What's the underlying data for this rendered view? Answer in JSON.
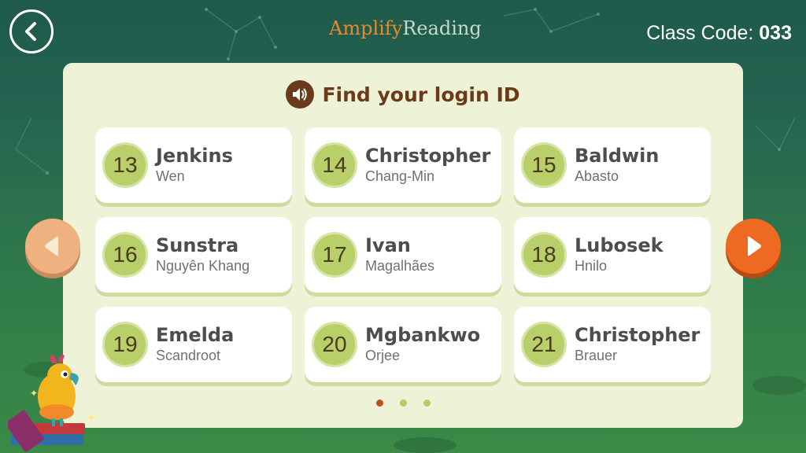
{
  "header": {
    "back_icon": "chevron-left-icon",
    "logo_part1": "Amplify",
    "logo_part2": "Reading",
    "class_code_label": "Class Code:",
    "class_code_value": "033"
  },
  "panel": {
    "title": "Find your login ID",
    "speaker_icon": "speaker-icon",
    "students": [
      {
        "id": "13",
        "first": "Jenkins",
        "last": "Wen"
      },
      {
        "id": "14",
        "first": "Christopher",
        "last": "Chang-Min"
      },
      {
        "id": "15",
        "first": "Baldwin",
        "last": "Abasto"
      },
      {
        "id": "16",
        "first": "Sunstra",
        "last": "Nguyên Khang"
      },
      {
        "id": "17",
        "first": "Ivan",
        "last": "Magalhães"
      },
      {
        "id": "18",
        "first": "Lubosek",
        "last": "Hnilo"
      },
      {
        "id": "19",
        "first": "Emelda",
        "last": "Scandroot"
      },
      {
        "id": "20",
        "first": "Mgbankwo",
        "last": "Orjee"
      },
      {
        "id": "21",
        "first": "Christopher",
        "last": "Brauer"
      }
    ],
    "pagination": {
      "pages": 3,
      "current": 1
    }
  },
  "navigation": {
    "prev_icon": "play-left-icon",
    "next_icon": "play-right-icon"
  },
  "colors": {
    "panel_bg": "#eef3d7",
    "title": "#6b3a1a",
    "badge": "#b8cf6a",
    "next_button": "#ee6a22",
    "prev_button": "#eeb17f",
    "active_dot": "#c0501c"
  }
}
